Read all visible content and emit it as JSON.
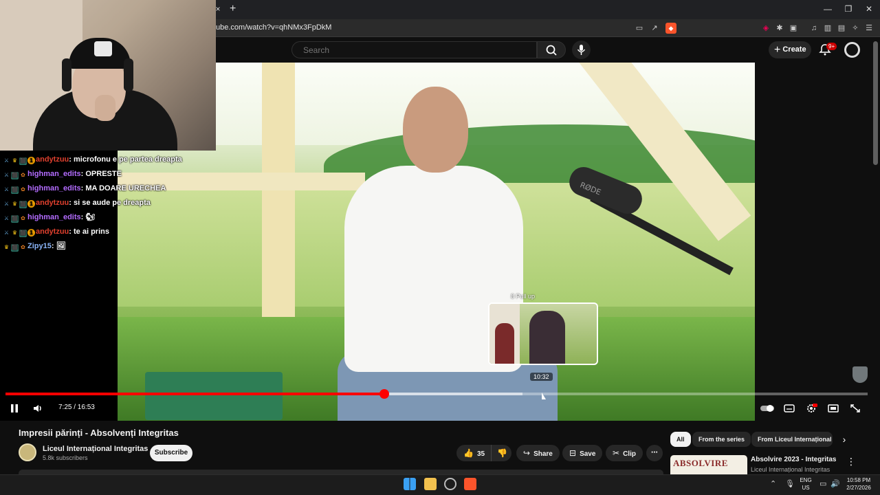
{
  "browser": {
    "tab_close": "×",
    "new_tab": "+",
    "url": "ube.com/watch?v=qhNMx3FpDkM",
    "window_controls": [
      "—",
      "❐",
      "✕"
    ]
  },
  "youtube": {
    "search_placeholder": "Search",
    "create_label": "Create",
    "notifications_badge": "9+",
    "mic_brand": "RØDE",
    "player": {
      "current_time": "7:25",
      "duration": "16:53",
      "time_display": "7:25 / 16:53",
      "played_fraction": 0.4392,
      "buffered_fraction": 0.6,
      "hover_time": "10:32",
      "hover_chapter": "8 Pull up"
    },
    "video": {
      "title": "Impresii părinți - Absolvenți Integritas",
      "channel": "Liceul Internațional Integritas",
      "subscribers": "5.8k subscribers",
      "subscribe_label": "Subscribe",
      "likes": "35",
      "share_label": "Share",
      "save_label": "Save",
      "clip_label": "Clip"
    },
    "chips": [
      {
        "label": "All",
        "active": true
      },
      {
        "label": "From the series",
        "active": false
      },
      {
        "label": "From Liceul Internațional",
        "active": false
      }
    ],
    "recommendation": {
      "thumb_text": "ABSOLVIRE",
      "title": "Absolvire 2023 - Integritas",
      "channel": "Liceul Internațional Integritas"
    }
  },
  "chat": [
    {
      "badges": [
        "sword",
        "crown",
        "tier",
        "num"
      ],
      "user": "andytzuu",
      "user_color": "red",
      "message": "microfonu e pe partea dreapta"
    },
    {
      "badges": [
        "sword",
        "tier",
        "pet"
      ],
      "user": "highman_edits",
      "user_color": "purple",
      "message": "OPRESTE"
    },
    {
      "badges": [
        "sword",
        "tier",
        "pet"
      ],
      "user": "highman_edits",
      "user_color": "purple",
      "message": "MA DOARE URECHEA"
    },
    {
      "badges": [
        "sword",
        "crown",
        "tier",
        "num"
      ],
      "user": "andytzuu",
      "user_color": "red",
      "message": "si se aude pe dreapta"
    },
    {
      "badges": [
        "sword",
        "tier",
        "pet"
      ],
      "user": "highman_edits",
      "user_color": "purple",
      "message": "🐿"
    },
    {
      "badges": [
        "sword",
        "crown",
        "tier",
        "num"
      ],
      "user": "andytzuu",
      "user_color": "red",
      "message": "te ai prins"
    },
    {
      "badges": [
        "crown",
        "tier",
        "pet"
      ],
      "user": "Zipy15",
      "user_color": "blue",
      "message": "🖼"
    }
  ],
  "taskbar": {
    "lang_top": "ENG",
    "lang_bottom": "US",
    "time": "10:58 PM",
    "date": "2/27/2026"
  },
  "colors": {
    "accent_red": "#ff0000",
    "bg": "#0f0f0f",
    "pill_bg": "#272727"
  }
}
